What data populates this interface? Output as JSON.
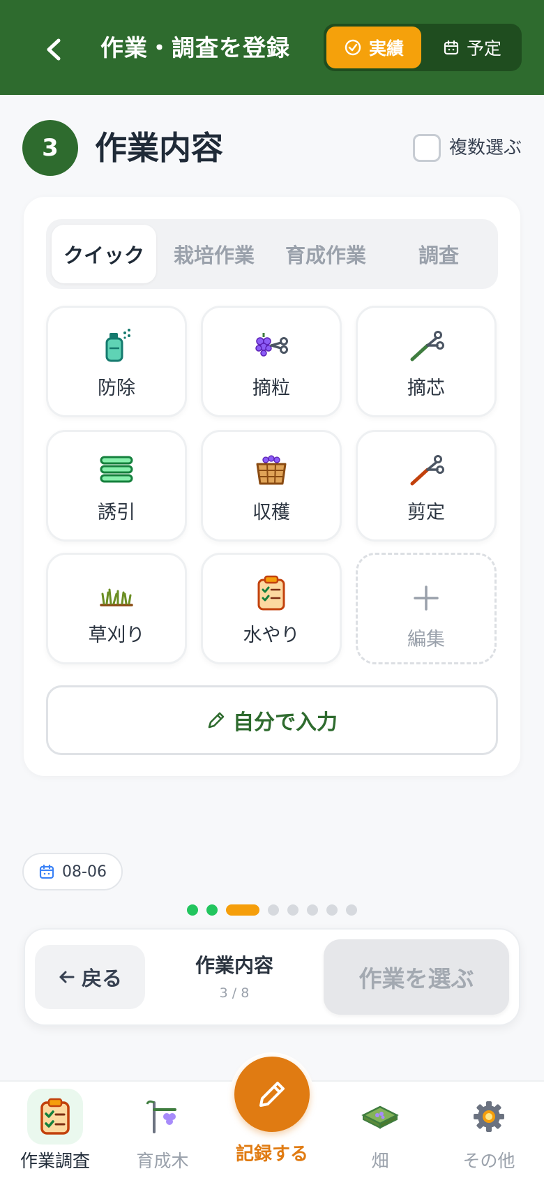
{
  "header": {
    "back_icon": "chevron-left-icon",
    "title": "作業・調査を登録",
    "mode_actual": "実績",
    "mode_plan": "予定"
  },
  "section": {
    "step_number": "3",
    "title": "作業内容",
    "multi_select_label": "複数選ぶ"
  },
  "tabs": [
    {
      "label": "クイック",
      "active": true
    },
    {
      "label": "栽培作業",
      "active": false
    },
    {
      "label": "育成作業",
      "active": false
    },
    {
      "label": "調査",
      "active": false
    }
  ],
  "tasks": [
    {
      "label": "防除",
      "icon": "sprayer-icon"
    },
    {
      "label": "摘粒",
      "icon": "grape-scissors-icon"
    },
    {
      "label": "摘芯",
      "icon": "pruner-icon"
    },
    {
      "label": "誘引",
      "icon": "tie-lines-icon"
    },
    {
      "label": "収穫",
      "icon": "basket-icon"
    },
    {
      "label": "剪定",
      "icon": "shears-icon"
    },
    {
      "label": "草刈り",
      "icon": "grass-icon"
    },
    {
      "label": "水やり",
      "icon": "clipboard-icon"
    },
    {
      "label": "編集",
      "icon": "plus-icon"
    }
  ],
  "custom_input_label": "自分で入力",
  "date_chip": "08-06",
  "pager": {
    "total": 8,
    "current": 3
  },
  "step_nav": {
    "back_label": "戻る",
    "step_name": "作業内容",
    "step_count": "3 / 8",
    "next_label": "作業を選ぶ"
  },
  "bottom_nav": [
    {
      "label": "作業調査",
      "icon": "clipboard-check-icon",
      "active": true
    },
    {
      "label": "育成木",
      "icon": "vine-icon",
      "active": false
    },
    {
      "label": "記録する",
      "icon": "pencil-icon",
      "active": false
    },
    {
      "label": "畑",
      "icon": "field-icon",
      "active": false
    },
    {
      "label": "その他",
      "icon": "gear-icon",
      "active": false
    }
  ],
  "colors": {
    "header_bg": "#2e6b2e",
    "accent_orange": "#f5a10b",
    "fab_orange": "#e07b12",
    "done_green": "#22c55e"
  }
}
